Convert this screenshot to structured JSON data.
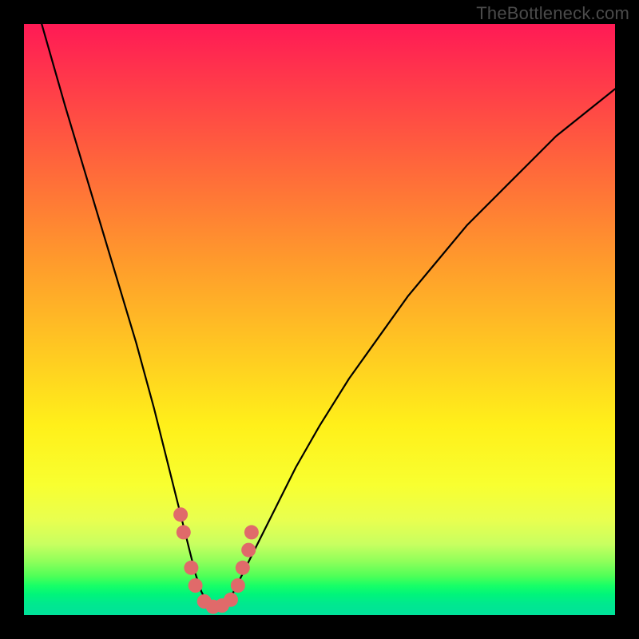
{
  "watermark": {
    "text": "TheBottleneck.com"
  },
  "colors": {
    "frame": "#000000",
    "curve": "#000000",
    "marker": "#e06a6a",
    "gradient_stops": [
      "#ff1a55",
      "#ff3a4a",
      "#ff6a3a",
      "#ff9a2c",
      "#ffc822",
      "#fff01a",
      "#f8ff30",
      "#e8ff50",
      "#c8ff60",
      "#8dff5a",
      "#4dff58",
      "#18ff66",
      "#00f57a",
      "#00e98e",
      "#00e29a"
    ]
  },
  "chart_data": {
    "type": "line",
    "title": "",
    "xlabel": "",
    "ylabel": "",
    "xlim": [
      0,
      100
    ],
    "ylim": [
      0,
      100
    ],
    "grid": false,
    "legend": false,
    "x_at_minimum": 32,
    "annotations": [],
    "series": [
      {
        "name": "bottleneck-curve",
        "x": [
          3,
          5,
          7,
          10,
          13,
          16,
          19,
          22,
          24,
          26,
          27,
          28,
          29,
          30,
          31,
          32,
          33,
          34,
          35,
          36,
          37,
          38,
          40,
          43,
          46,
          50,
          55,
          60,
          65,
          70,
          75,
          80,
          85,
          90,
          95,
          100
        ],
        "y": [
          100,
          93,
          86,
          76,
          66,
          56,
          46,
          35,
          27,
          19,
          15,
          11,
          7,
          4,
          2,
          1,
          1,
          2,
          3,
          5,
          7,
          9,
          13,
          19,
          25,
          32,
          40,
          47,
          54,
          60,
          66,
          71,
          76,
          81,
          85,
          89
        ]
      }
    ],
    "markers": {
      "name": "highlight-dots",
      "points": [
        {
          "x": 26.5,
          "y": 17
        },
        {
          "x": 27.0,
          "y": 14
        },
        {
          "x": 28.3,
          "y": 8
        },
        {
          "x": 29.0,
          "y": 5
        },
        {
          "x": 30.5,
          "y": 2.3
        },
        {
          "x": 32.0,
          "y": 1.4
        },
        {
          "x": 33.5,
          "y": 1.6
        },
        {
          "x": 35.0,
          "y": 2.6
        },
        {
          "x": 36.2,
          "y": 5
        },
        {
          "x": 37.0,
          "y": 8
        },
        {
          "x": 38.0,
          "y": 11
        },
        {
          "x": 38.5,
          "y": 14
        }
      ],
      "radius": 9
    }
  }
}
